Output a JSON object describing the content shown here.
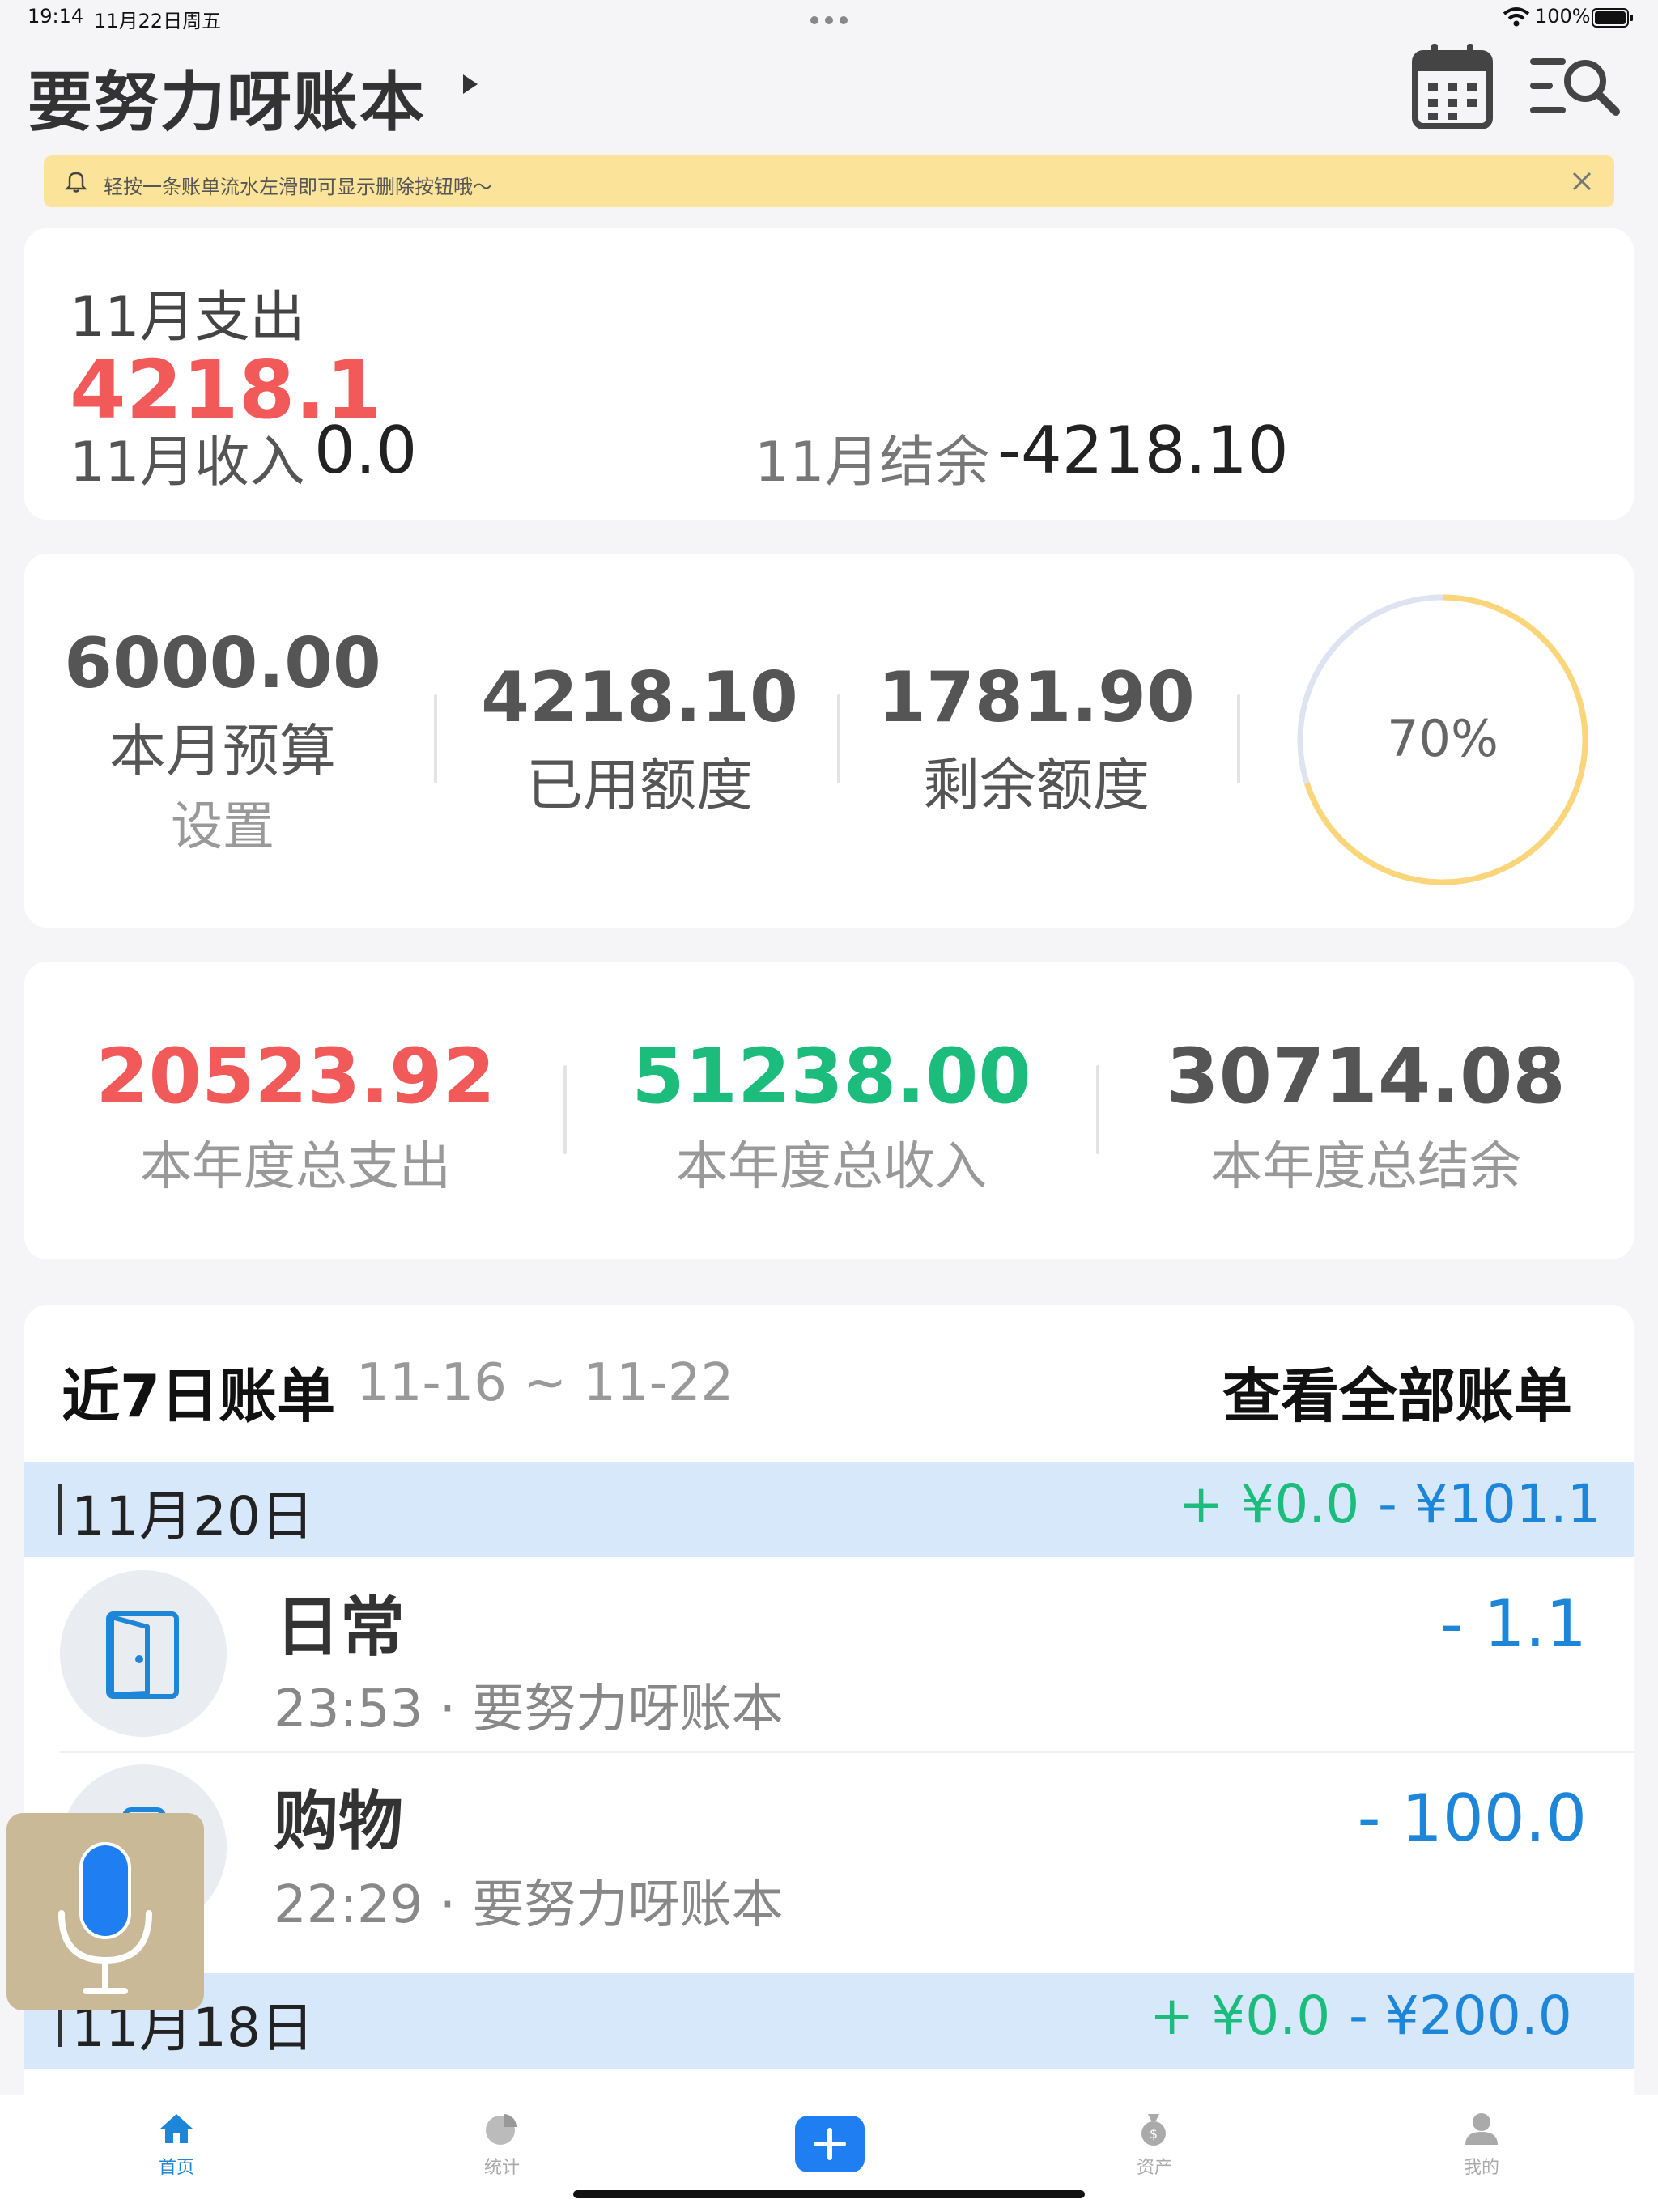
{
  "status_bar": {
    "time": "19:14",
    "date": "11月22日周五",
    "battery": "100%"
  },
  "header": {
    "title": "要努力呀账本"
  },
  "notice": {
    "text": "轻按一条账单流水左滑即可显示删除按钮哦～"
  },
  "month_summary": {
    "expense_label": "11月支出",
    "expense_value": "4218.1",
    "income_label": "11月收入",
    "income_value": "0.0",
    "balance_label": "11月结余",
    "balance_value": "-4218.10"
  },
  "budget": {
    "budget_value": "6000.00",
    "budget_label": "本月预算",
    "setting_label": "设置",
    "used_value": "4218.10",
    "used_label": "已用额度",
    "remaining_value": "1781.90",
    "remaining_label": "剩余额度",
    "percent_text": "70%",
    "percent_fraction": 0.7
  },
  "year_summary": {
    "expense_value": "20523.92",
    "expense_label": "本年度总支出",
    "income_value": "51238.00",
    "income_label": "本年度总收入",
    "balance_value": "30714.08",
    "balance_label": "本年度总结余"
  },
  "recent": {
    "title": "近7日账单",
    "range": "11-16 ~ 11-22",
    "view_all": "查看全部账单",
    "days": [
      {
        "date": "11月20日",
        "income": "+ ¥0.0",
        "expense": "- ¥101.1",
        "entries": [
          {
            "category": "日常",
            "meta": "23:53 · 要努力呀账本",
            "amount": "- 1.1"
          },
          {
            "category": "购物",
            "meta": "22:29 · 要努力呀账本",
            "amount": "- 100.0"
          }
        ]
      },
      {
        "date": "11月18日",
        "income": "+ ¥0.0",
        "expense": "- ¥200.0"
      }
    ]
  },
  "tabs": [
    {
      "label": "首页"
    },
    {
      "label": "统计"
    },
    {
      "label": "资产"
    },
    {
      "label": "我的"
    }
  ],
  "colors": {
    "accent": "#1e86d8",
    "expense_red": "#f25a5a",
    "income_green": "#1cbc7c",
    "ring_fill": "#fbd57a",
    "ring_track": "#dde3f1"
  }
}
